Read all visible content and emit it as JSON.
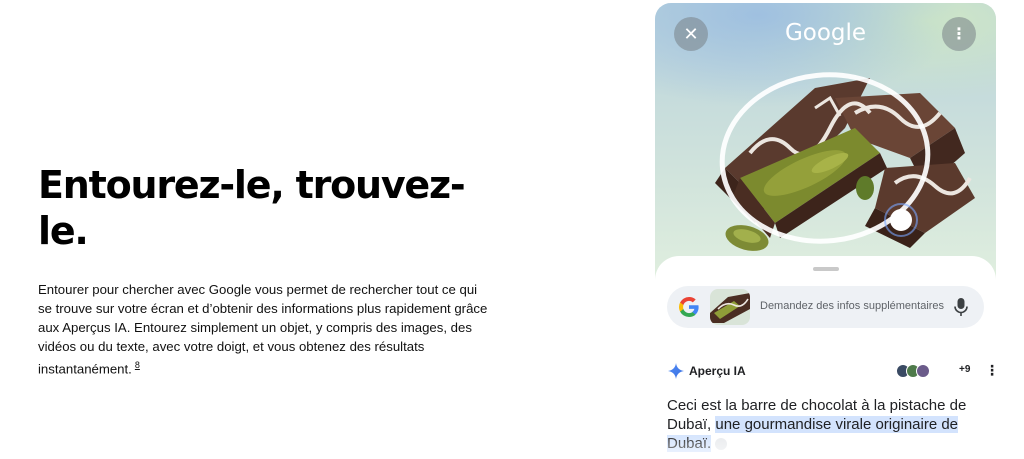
{
  "hero": {
    "title": "Entourez-le, trouvez-le.",
    "body": "Entourer pour chercher avec Google vous permet de rechercher tout ce qui se trouve sur votre écran et d’obtenir des informations plus rapidement grâce aux Aperçus IA. Entourez simplement un objet, y compris des images, des vidéos ou du texte, avec votre doigt, et vous obtenez des résultats instantanément.",
    "footnote": "8"
  },
  "phone": {
    "header": {
      "logo": "Google",
      "close_icon": "close-icon",
      "more_icon": "more-vert-icon"
    },
    "search": {
      "placeholder": "Demandez des infos supplémentaires",
      "logo_icon": "google-g-icon",
      "mic_icon": "mic-icon"
    },
    "ai_overview": {
      "label": "Aperçu IA",
      "source_count": "+9",
      "more_icon": "more-vert-icon",
      "answer_plain": "Ceci est la barre de chocolat à la pistache de Dubaï, ",
      "answer_highlight": "une gourmandise virale originaire de Dubaï."
    }
  },
  "colors": {
    "highlight": "#d3e3fd",
    "google_blue": "#4285F4",
    "google_red": "#EA4335",
    "google_yellow": "#FBBC05",
    "google_green": "#34A853"
  }
}
